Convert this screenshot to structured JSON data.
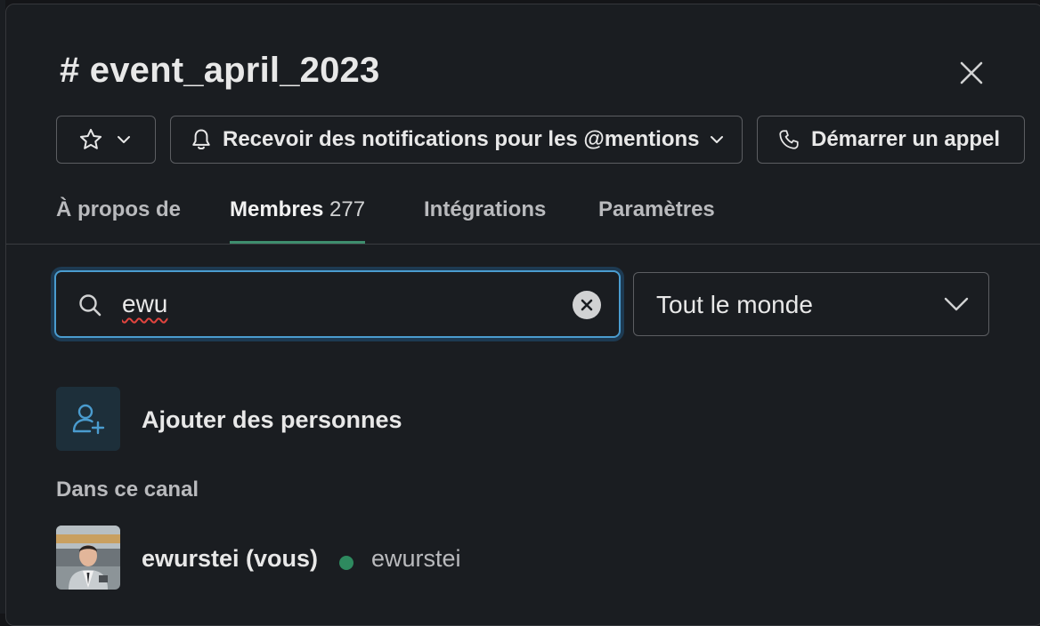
{
  "channel": {
    "prefix": "#",
    "name": "event_april_2023"
  },
  "header": {
    "notifications_label": "Recevoir des notifications pour les @mentions",
    "call_label": "Démarrer un appel"
  },
  "tabs": [
    {
      "label": "À propos de",
      "count": ""
    },
    {
      "label": "Membres",
      "count": "277"
    },
    {
      "label": "Intégrations",
      "count": ""
    },
    {
      "label": "Paramètres",
      "count": ""
    }
  ],
  "search": {
    "value": "ewu"
  },
  "filter": {
    "selected": "Tout le monde"
  },
  "add_people": {
    "label": "Ajouter des personnes"
  },
  "section": {
    "label": "Dans ce canal"
  },
  "members": [
    {
      "name": "ewurstei (vous)",
      "handle": "ewurstei",
      "status": "active"
    }
  ],
  "colors": {
    "background": "#1a1d21",
    "accent_tab": "#3e8e6e",
    "focus_ring": "#4a9ccf",
    "status_active": "#2e8a5f",
    "add_tile": "#1d2f3a"
  },
  "icons": [
    "star-icon",
    "chevron-down-icon",
    "bell-icon",
    "phone-icon",
    "close-icon",
    "search-icon",
    "clear-icon",
    "add-user-icon"
  ]
}
